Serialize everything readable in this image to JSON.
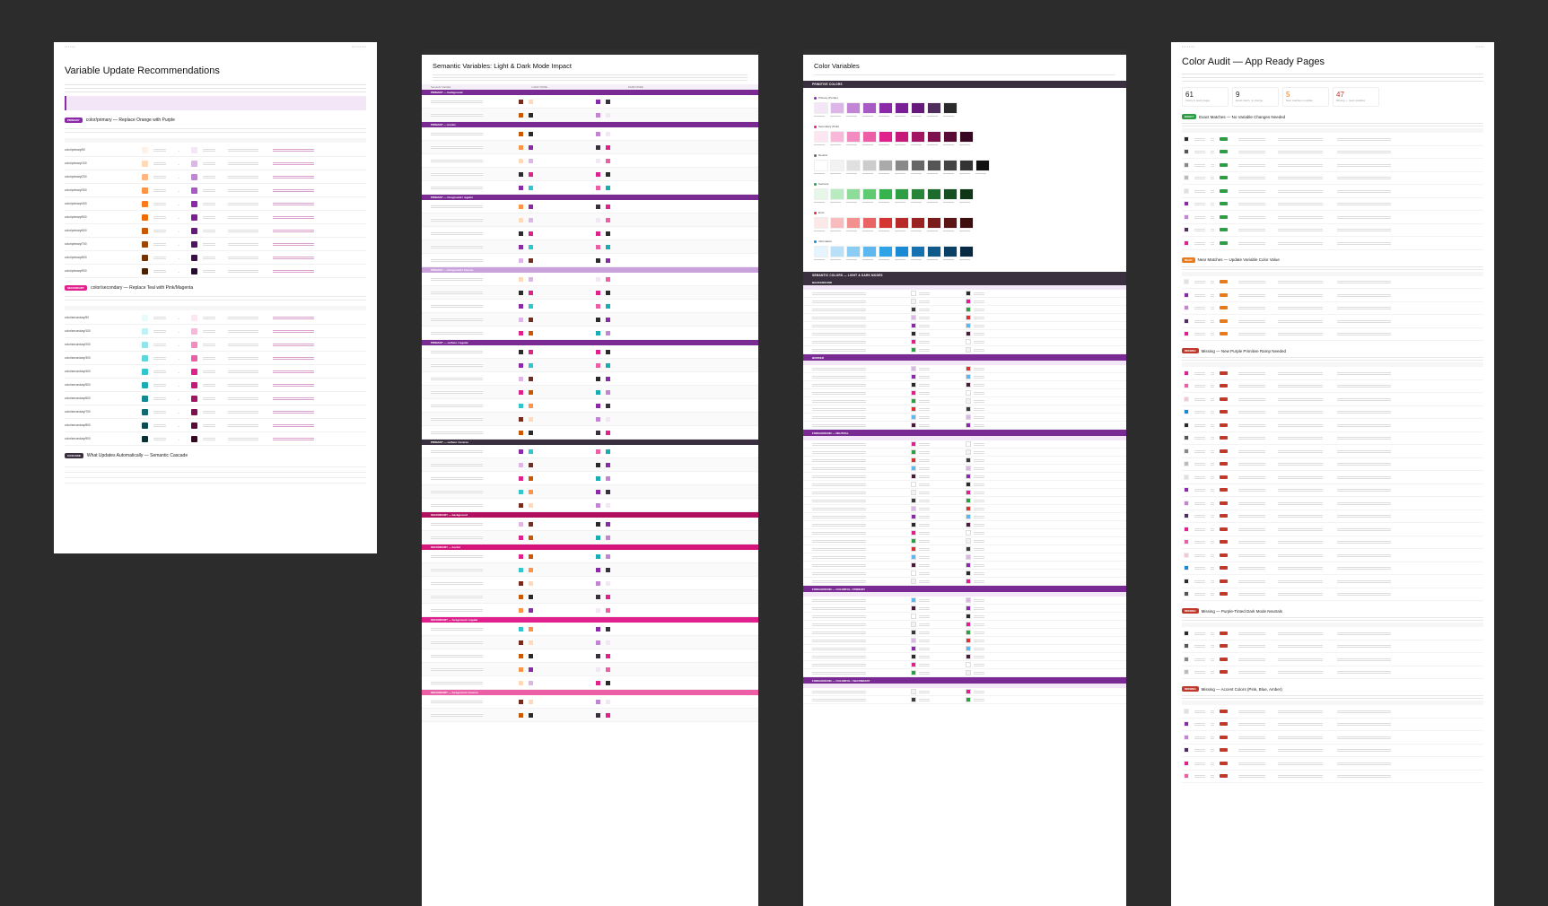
{
  "frames": {
    "recommendations": {
      "title": "Variable Update Recommendations",
      "sections": [
        {
          "tag": "PRIMARY",
          "heading": "color/primary — Replace Orange with Purple",
          "tag_color": "#8a2aa8"
        },
        {
          "tag": "SECONDARY",
          "heading": "color/secondary — Replace Teal with Pink/Magenta",
          "tag_color": "#e0208c"
        },
        {
          "tag": "CASCADE",
          "heading": "What Updates Automatically — Semantic Cascade",
          "tag_color": "#3a2f3e"
        }
      ],
      "primary_rows": [
        "color/primary/50",
        "color/primary/100",
        "color/primary/200",
        "color/primary/300",
        "color/primary/400",
        "color/primary/500",
        "color/primary/600",
        "color/primary/700",
        "color/primary/800",
        "color/primary/900"
      ],
      "secondary_rows": [
        "color/secondary/50",
        "color/secondary/100",
        "color/secondary/200",
        "color/secondary/300",
        "color/secondary/400",
        "color/secondary/500",
        "color/secondary/600",
        "color/secondary/700",
        "color/secondary/800",
        "color/secondary/900"
      ],
      "primary_current": [
        "#fff1e6",
        "#ffd9b8",
        "#ffb680",
        "#ff9447",
        "#ff7a1a",
        "#f06a00",
        "#c95800",
        "#9e4500",
        "#733200",
        "#4a2000"
      ],
      "primary_new": [
        "#f3e6f7",
        "#dcb6e8",
        "#c285d6",
        "#a85ac4",
        "#8a2aa8",
        "#7a1f96",
        "#64197b",
        "#4f1361",
        "#3b0e48",
        "#280930"
      ],
      "secondary_current": [
        "#e6fbfb",
        "#bff2f4",
        "#8fe6ea",
        "#5cd7dc",
        "#2fc6cd",
        "#18adb5",
        "#138a91",
        "#0f6b70",
        "#0a4c50",
        "#063033"
      ],
      "secondary_new": [
        "#fde6f2",
        "#f9b8d9",
        "#f48bc0",
        "#ec5ea6",
        "#e0208c",
        "#c51a7a",
        "#a11563",
        "#7d104d",
        "#590b37",
        "#370722"
      ]
    },
    "semantic": {
      "title": "Semantic Variables: Light & Dark Mode Impact",
      "col_headers": [
        "Semantic Variable",
        "LIGHT MODE",
        "DARK MODE"
      ],
      "groups": [
        {
          "label": "PRIMARY — background",
          "color": "#7a2a93",
          "rows": 2
        },
        {
          "label": "PRIMARY — border",
          "color": "#7a2a93",
          "rows": 5
        },
        {
          "label": "PRIMARY — foreground / regular",
          "color": "#7a2a93",
          "rows": 5
        },
        {
          "label": "PRIMARY — foreground / inverse",
          "color": "#c9a2dc",
          "rows": 5
        },
        {
          "label": "PRIMARY — surface / regular",
          "color": "#7a2a93",
          "rows": 7
        },
        {
          "label": "PRIMARY — surface / inverse",
          "color": "#3a2f3e",
          "rows": 5
        },
        {
          "label": "SECONDARY — background",
          "color": "#b0105f",
          "rows": 2
        },
        {
          "label": "SECONDARY — border",
          "color": "#d4147a",
          "rows": 5
        },
        {
          "label": "SECONDARY — foreground / regular",
          "color": "#e0208c",
          "rows": 5
        },
        {
          "label": "SECONDARY — foreground / inverse",
          "color": "#ec5ea6",
          "rows": 2
        }
      ]
    },
    "colors": {
      "title": "Color Variables",
      "section_primitives": "PRIMITIVE COLORS",
      "section_semantic": "SEMANTIC COLORS — LIGHT & DARK MODES",
      "palettes": [
        {
          "name": "Primary (Purple)",
          "dot": "#8a2aa8",
          "swatches": [
            "#f3e6f7",
            "#dcb6e8",
            "#c285d6",
            "#a85ac4",
            "#8a2aa8",
            "#7a1f96",
            "#64197b",
            "#4f2d5c",
            "#2a2a2a"
          ]
        },
        {
          "name": "Secondary (Pink)",
          "dot": "#e0208c",
          "swatches": [
            "#fde6f2",
            "#f9b8d9",
            "#f48bc0",
            "#ec5ea6",
            "#e0208c",
            "#c51a7a",
            "#a11563",
            "#7d104d",
            "#590b37",
            "#370722"
          ]
        },
        {
          "name": "Neutral",
          "dot": "#666666",
          "swatches": [
            "#ffffff",
            "#f2f2f2",
            "#e0e0e0",
            "#cccccc",
            "#aaaaaa",
            "#888888",
            "#666666",
            "#555555",
            "#444444",
            "#333333",
            "#111111"
          ]
        },
        {
          "name": "Success",
          "dot": "#2e9e45",
          "swatches": [
            "#e6f7e9",
            "#b9ebc1",
            "#8ddc99",
            "#5ecb70",
            "#35b34c",
            "#2e9e45",
            "#268539",
            "#1e6b2e",
            "#164f22",
            "#0f3517"
          ]
        },
        {
          "name": "Error",
          "dot": "#d63333",
          "swatches": [
            "#fde8e8",
            "#f9bcbc",
            "#f39090",
            "#ea6363",
            "#d63333",
            "#b82a2a",
            "#992323",
            "#7a1c1c",
            "#5c1515",
            "#3d0e0e"
          ]
        },
        {
          "name": "Information",
          "dot": "#1a8ad4",
          "swatches": [
            "#e6f4fd",
            "#b8e0f9",
            "#8accf4",
            "#5cb8ee",
            "#2ea4e6",
            "#1a8ad4",
            "#1571b0",
            "#10598b",
            "#0b4066",
            "#072942"
          ]
        }
      ],
      "semantic_groups": [
        {
          "label": "BACKGROUND",
          "rows": 8
        },
        {
          "label": "BORDER",
          "rows": 8
        },
        {
          "label": "FOREGROUND — NEUTRAL",
          "rows": 18
        },
        {
          "label": "FOREGROUND — COLORFUL / PRIMARY",
          "rows": 10
        },
        {
          "label": "FOREGROUND — COLORFUL / SECONDARY",
          "rows": 2
        }
      ]
    },
    "audit": {
      "title": "Color Audit — App Ready Pages",
      "stats": [
        {
          "value": "61",
          "label": "Colors in ready pages"
        },
        {
          "value": "9",
          "label": "Exact match, no change"
        },
        {
          "value": "5",
          "label": "Near matches to update"
        },
        {
          "value": "47",
          "label": "Missing — need variables"
        }
      ],
      "stat_colors": [
        "#222222",
        "#222222",
        "#e87a1a",
        "#c0392b"
      ],
      "sections": [
        {
          "tag": "EXACT",
          "tag_color": "#2e9e45",
          "heading": "Exact Matches — No Variable Changes Needed",
          "rows": 9
        },
        {
          "tag": "NEAR",
          "tag_color": "#e87a1a",
          "heading": "Near Matches — Update Variable Color Value",
          "rows": 5
        },
        {
          "tag": "MISSING",
          "tag_color": "#c0392b",
          "heading": "Missing — New Purple Primitive Ramp Needed",
          "rows": 18
        },
        {
          "tag": "MISSING",
          "tag_color": "#c0392b",
          "heading": "Missing — Purple-Tinted Dark Mode Neutrals",
          "rows": 4
        },
        {
          "tag": "MISSING",
          "tag_color": "#c0392b",
          "heading": "Missing — Accent Colors (Pink, Blue, Amber)",
          "rows": 6
        }
      ]
    }
  }
}
